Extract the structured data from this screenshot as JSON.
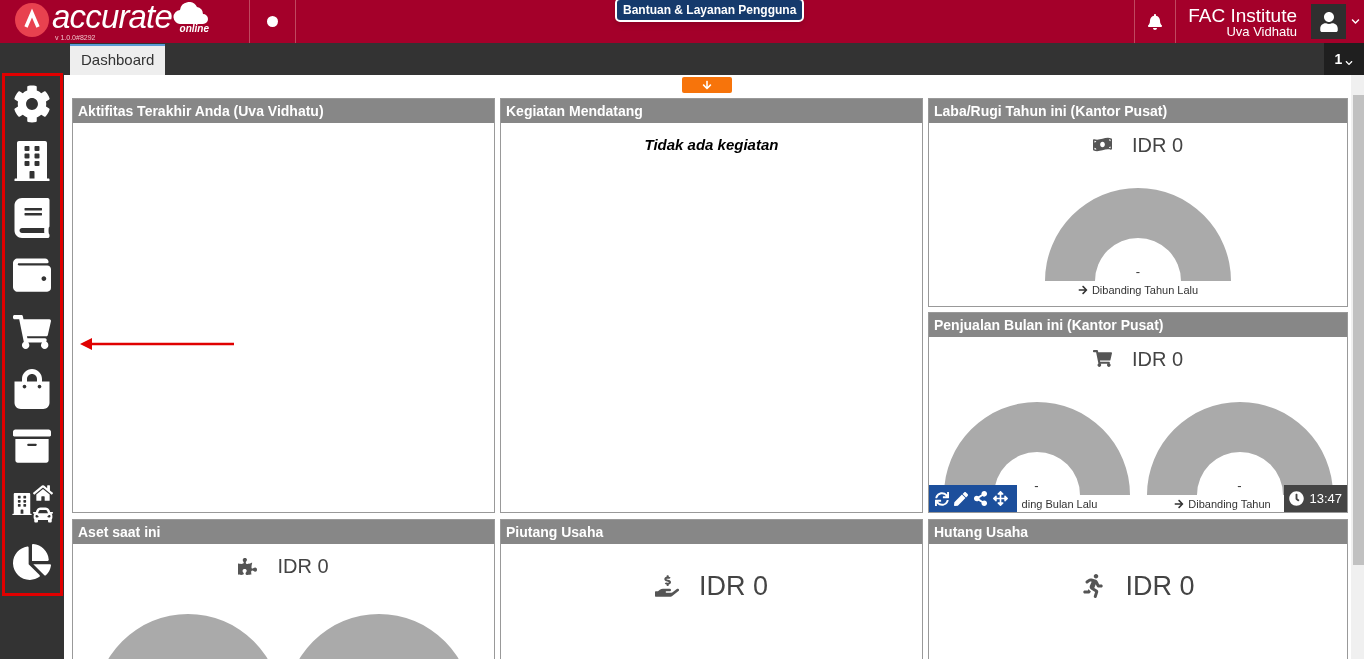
{
  "header": {
    "logo": "accurate",
    "logo_sub": "online",
    "version": "v 1.0.0#8292",
    "help_button": "Bantuan & Layanan Pengguna",
    "company": "FAC Institute",
    "user": "Uva Vidhatu"
  },
  "tabs": [
    {
      "label": "Dashboard",
      "selected": true
    }
  ],
  "tab_counter": "1",
  "widgets": [
    {
      "kind": "activity",
      "title": "Aktifitas Terakhir Anda (Uva Vidhatu)"
    },
    {
      "kind": "events",
      "title": "Kegiatan Mendatang",
      "message": "Tidak ada kegiatan"
    },
    {
      "kind": "gauges",
      "title": "Laba/Rugi Tahun ini (Kantor Pusat)",
      "amount": "IDR 0",
      "gauges": [
        {
          "value": "-",
          "caption": "Dibanding Tahun Lalu",
          "arrow": true
        }
      ]
    },
    {
      "kind": "gauges",
      "title": "Penjualan Bulan ini (Kantor Pusat)",
      "amount": "IDR 0",
      "gauges": [
        {
          "value": "-",
          "caption": "ding Bulan Lalu",
          "arrow": false
        },
        {
          "value": "-",
          "caption": "Dibanding Tahun",
          "arrow": true
        }
      ],
      "toolbar": true,
      "time": "13:47"
    },
    {
      "kind": "gauges",
      "title": "Aset saat ini",
      "amount": "IDR 0",
      "gauges": [
        {
          "kind": "arc"
        },
        {
          "kind": "arc"
        }
      ]
    },
    {
      "kind": "amount",
      "title": "Piutang Usaha",
      "amount": "IDR 0"
    },
    {
      "kind": "amount",
      "title": "Hutang Usaha",
      "amount": "IDR 0"
    }
  ]
}
